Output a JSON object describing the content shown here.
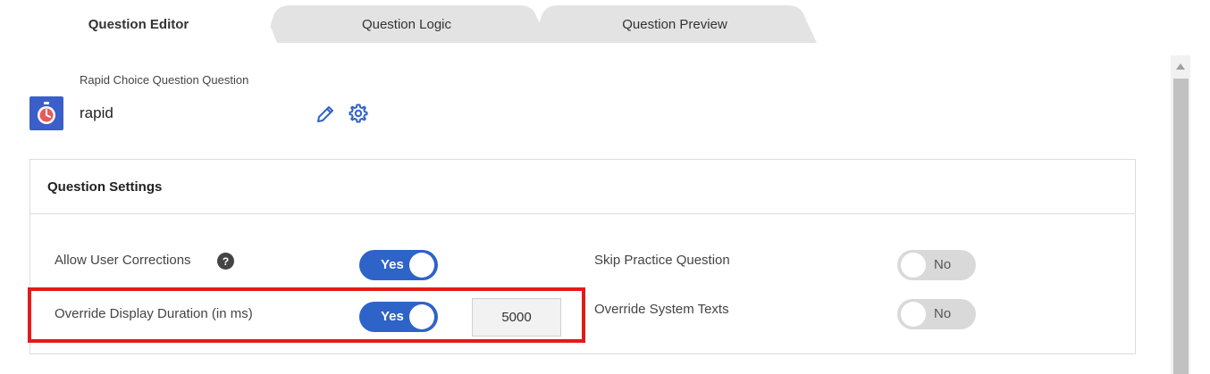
{
  "tabs": [
    {
      "label": "Question Editor",
      "active": true
    },
    {
      "label": "Question Logic",
      "active": false
    },
    {
      "label": "Question Preview",
      "active": false
    }
  ],
  "question": {
    "type_label": "Rapid Choice Question Question",
    "name": "rapid",
    "icon": "stopwatch-icon"
  },
  "settings": {
    "title": "Question Settings",
    "allow_user_corrections": {
      "label": "Allow User Corrections",
      "value": "Yes",
      "on": true
    },
    "override_display_duration": {
      "label": "Override Display Duration (in ms)",
      "value": "Yes",
      "on": true,
      "duration": "5000"
    },
    "skip_practice_question": {
      "label": "Skip Practice Question",
      "value": "No",
      "on": false
    },
    "override_system_texts": {
      "label": "Override System Texts",
      "value": "No",
      "on": false
    }
  },
  "help_glyph": "?",
  "colors": {
    "accent": "#2e63c8",
    "icon_bg": "#3b5fc9",
    "toggle_off": "#d9d9d9",
    "highlight": "#e31a1a"
  }
}
